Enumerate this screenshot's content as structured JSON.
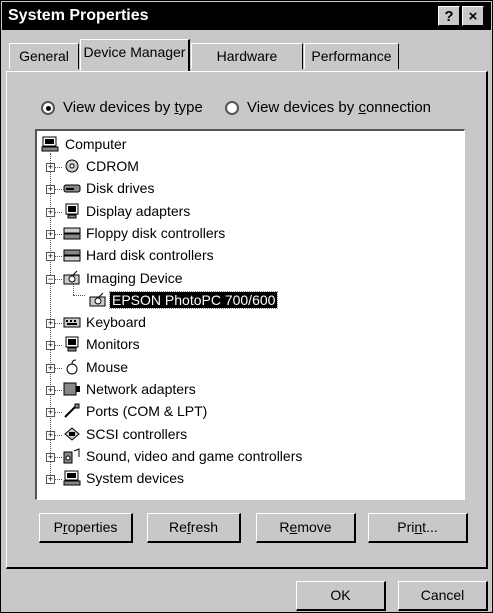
{
  "window": {
    "title": "System Properties",
    "help_label": "?",
    "close_label": "×"
  },
  "tabs": [
    {
      "label": "General"
    },
    {
      "label": "Device Manager"
    },
    {
      "label": "Hardware Profiles"
    },
    {
      "label": "Performance"
    }
  ],
  "view": {
    "by_type": {
      "pre": "View devices by ",
      "u": "t",
      "post": "ype",
      "selected": true
    },
    "by_connection": {
      "pre": "View devices by ",
      "u": "c",
      "post": "onnection",
      "selected": false
    }
  },
  "tree": {
    "root": "Computer",
    "items": [
      {
        "label": "CDROM",
        "icon": "cdrom-icon",
        "expander": "+"
      },
      {
        "label": "Disk drives",
        "icon": "disk-drive-icon",
        "expander": "+"
      },
      {
        "label": "Display adapters",
        "icon": "monitor-icon",
        "expander": "+"
      },
      {
        "label": "Floppy disk controllers",
        "icon": "floppy-controller-icon",
        "expander": "+"
      },
      {
        "label": "Hard disk controllers",
        "icon": "hard-disk-controller-icon",
        "expander": "+"
      },
      {
        "label": "Imaging Device",
        "icon": "camera-icon",
        "expander": "−"
      },
      {
        "label": "EPSON PhotoPC 700/600",
        "icon": "camera-icon",
        "child": true
      },
      {
        "label": "Keyboard",
        "icon": "keyboard-icon",
        "expander": "+"
      },
      {
        "label": "Monitors",
        "icon": "monitor-icon",
        "expander": "+"
      },
      {
        "label": "Mouse",
        "icon": "mouse-icon",
        "expander": "+"
      },
      {
        "label": "Network adapters",
        "icon": "network-adapter-icon",
        "expander": "+"
      },
      {
        "label": "Ports (COM & LPT)",
        "icon": "port-icon",
        "expander": "+"
      },
      {
        "label": "SCSI controllers",
        "icon": "scsi-icon",
        "expander": "+"
      },
      {
        "label": "Sound, video and game controllers",
        "icon": "sound-icon",
        "expander": "+"
      },
      {
        "label": "System devices",
        "icon": "computer-icon",
        "expander": "+"
      }
    ],
    "selected": "EPSON PhotoPC 700/600"
  },
  "buttons": {
    "properties": {
      "pre": "P",
      "u": "r",
      "post": "operties"
    },
    "refresh": {
      "pre": "Re",
      "u": "f",
      "post": "resh"
    },
    "remove": {
      "pre": "R",
      "u": "e",
      "post": "move"
    },
    "print": {
      "pre": "Pri",
      "u": "n",
      "post": "t..."
    },
    "ok": "OK",
    "cancel": "Cancel"
  }
}
